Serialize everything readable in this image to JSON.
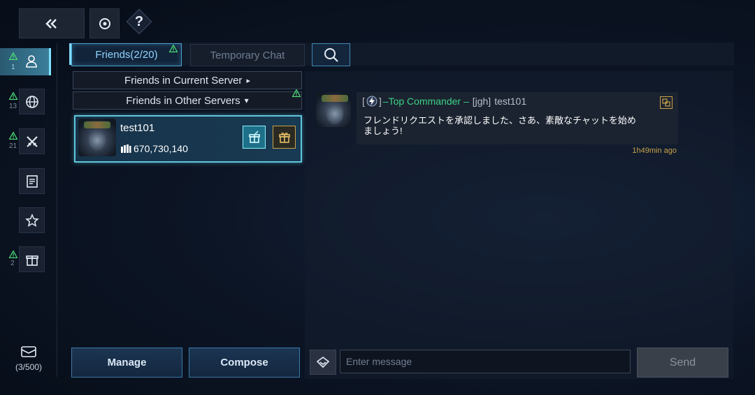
{
  "top": {
    "back_icon": "double-chevron-left-icon",
    "target_icon": "target-icon",
    "help_label": "?"
  },
  "tabs": [
    {
      "label": "Friends(2/20)",
      "active": true,
      "alert": true
    },
    {
      "label": "Temporary Chat",
      "active": false
    }
  ],
  "search_icon": "search-icon",
  "sidebar": {
    "items": [
      {
        "icon": "person-icon",
        "count": "1",
        "active": true,
        "alert": true
      },
      {
        "icon": "globe-icon",
        "count": "13",
        "alert": true
      },
      {
        "icon": "crossed-swords-icon",
        "count": "21",
        "alert": true
      },
      {
        "icon": "document-icon",
        "count": ""
      },
      {
        "icon": "star-icon",
        "count": ""
      },
      {
        "icon": "gift-icon",
        "count": "2",
        "alert": true
      }
    ],
    "mail_icon": "mail-icon",
    "mail_count": "(3/500)"
  },
  "friends": {
    "sections": [
      {
        "label": "Friends in Current Server",
        "arrow": "▸"
      },
      {
        "label": "Friends in Other Servers",
        "arrow": "▾",
        "alert": true
      }
    ],
    "list": [
      {
        "name": "test101",
        "power": "670,730,140"
      }
    ],
    "manage_label": "Manage",
    "compose_label": "Compose"
  },
  "chat": {
    "messages": [
      {
        "rank": "–Top Commander –",
        "tag": "[jgh]",
        "sender": "test101",
        "body": "フレンドリクエストを承認しました、さあ、素敵なチャットを始めましょう!",
        "time": "1h49min ago"
      }
    ],
    "input_placeholder": "Enter message",
    "send_label": "Send"
  },
  "colors": {
    "accent": "#5fc6dc",
    "rank_green": "#3ed186",
    "gold": "#c9a24a",
    "alert_green": "#4ee07a"
  }
}
